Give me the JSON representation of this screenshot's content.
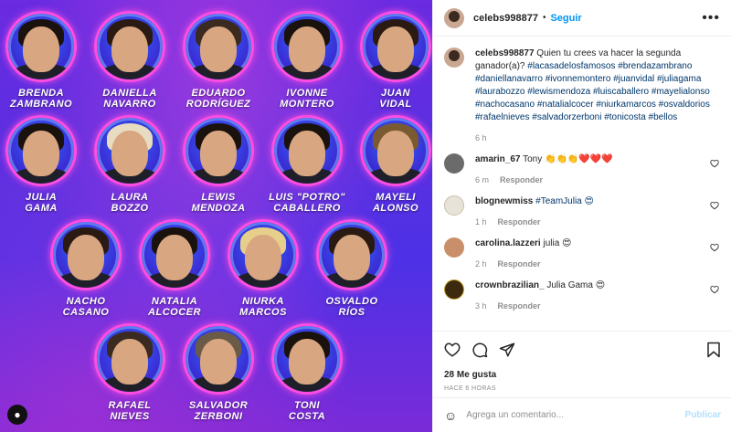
{
  "photo": {
    "celebs": [
      {
        "name": "Brenda\nZambrano"
      },
      {
        "name": "Daniella\nNavarro"
      },
      {
        "name": "Eduardo\nRodríguez"
      },
      {
        "name": "Ivonne\nMontero"
      },
      {
        "name": "Juan\nVidal"
      },
      {
        "name": "Julia\nGama"
      },
      {
        "name": "Laura\nBozzo"
      },
      {
        "name": "Lewis\nMendoza"
      },
      {
        "name": "Luis \"Potro\"\nCaballero"
      },
      {
        "name": "Mayeli\nAlonso"
      },
      {
        "name": "Nacho\nCasano"
      },
      {
        "name": "Natalia\nAlcocer"
      },
      {
        "name": "Niurka\nMarcos"
      },
      {
        "name": "Osvaldo\nRíos"
      },
      {
        "name": "Rafael\nNieves"
      },
      {
        "name": "Salvador\nZerboni"
      },
      {
        "name": "Toni\nCosta"
      }
    ],
    "user_tag_icon": "user-icon"
  },
  "header": {
    "username": "celebs998877",
    "separator": "•",
    "follow_label": "Seguir",
    "more_icon": "more-icon"
  },
  "caption": {
    "username": "celebs998877",
    "text": "Quien tu crees va hacer la segunda ganador(a)?",
    "hashtags": "#lacasadelosfamosos #brendazambrano #daniellanavarro #ivonnemontero #juanvidal #juliagama #laurabozzo #lewismendoza #luiscaballero #mayelialonso #nachocasano #natalialcocer #niurkamarcos #osvaldorios #rafaelnieves #salvadorzerboni #tonicosta #bellos",
    "time": "6 h"
  },
  "comments": [
    {
      "username": "amarin_67",
      "text": "Tony 👏👏👏❤️❤️❤️",
      "time": "6 m",
      "reply": "Responder"
    },
    {
      "username": "blognewmiss",
      "text": "#TeamJulia 😍",
      "time": "1 h",
      "reply": "Responder"
    },
    {
      "username": "carolina.lazzeri",
      "text": "julia 😍",
      "time": "2 h",
      "reply": "Responder"
    },
    {
      "username": "crownbrazilian_",
      "text": "Julia Gama 😍",
      "time": "3 h",
      "reply": "Responder"
    }
  ],
  "actions": {
    "likes": "28 Me gusta",
    "ago": "Hace 6 horas"
  },
  "add_comment": {
    "placeholder": "Agrega un comentario...",
    "publish_label": "Publicar"
  },
  "colors": {
    "accent": "#0095f6",
    "link": "#00376b",
    "muted": "#8e8e8e",
    "publish_disabled": "#b2dffc",
    "ring": "#ff4de1"
  }
}
